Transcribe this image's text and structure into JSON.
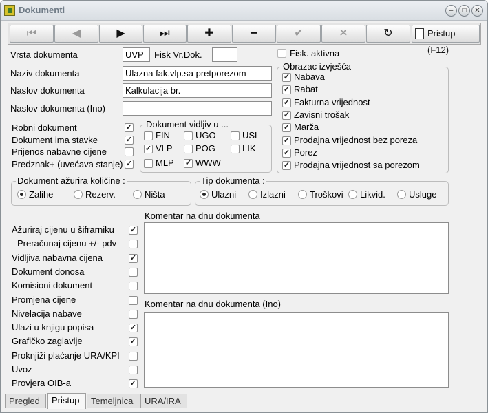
{
  "window": {
    "title": "Dokumenti"
  },
  "toolbar": {
    "first": "⏮",
    "prev": "◀",
    "next": "▶",
    "last": "⏭",
    "add": "✚",
    "remove": "━",
    "confirm": "✔",
    "cancel": "✕",
    "refresh": "↻",
    "pristup": "Pristup (F12)"
  },
  "fields": {
    "vrsta_label": "Vrsta dokumenta",
    "vrsta_value": "UVP",
    "fisk_label": "Fisk Vr.Dok.",
    "fisk_value": "",
    "fisk_aktivna_label": "Fisk. aktivna",
    "naziv_label": "Naziv dokumenta",
    "naziv_value": "Ulazna fak.vlp.sa pretporezom",
    "naslov_label": "Naslov dokumenta",
    "naslov_value": "Kalkulacija br.",
    "naslov_ino_label": "Naslov dokumenta (Ino)",
    "naslov_ino_value": ""
  },
  "left_checks": [
    {
      "label": "Robni dokument",
      "checked": true
    },
    {
      "label": "Dokument ima stavke",
      "checked": true
    },
    {
      "label": "Prijenos nabavne cijene",
      "checked": false
    },
    {
      "label": "Predznak+ (uvećava stanje)",
      "checked": true
    }
  ],
  "vidljiv": {
    "legend": "Dokument vidljiv u ...",
    "items": [
      {
        "label": "FIN",
        "checked": false
      },
      {
        "label": "UGO",
        "checked": false
      },
      {
        "label": "USL",
        "checked": false
      },
      {
        "label": "VLP",
        "checked": true
      },
      {
        "label": "POG",
        "checked": false
      },
      {
        "label": "LIK",
        "checked": false
      },
      {
        "label": "MLP",
        "checked": false
      },
      {
        "label": "WWW",
        "checked": true
      }
    ]
  },
  "obrazac": {
    "legend": "Obrazac izvješća",
    "items": [
      {
        "label": "Nabava",
        "checked": true
      },
      {
        "label": "Rabat",
        "checked": true
      },
      {
        "label": "Fakturna vrijednost",
        "checked": true
      },
      {
        "label": "Zavisni trošak",
        "checked": true
      },
      {
        "label": "Marža",
        "checked": true
      },
      {
        "label": "Prodajna vrijednost bez poreza",
        "checked": true
      },
      {
        "label": "Porez",
        "checked": true
      },
      {
        "label": "Prodajna vrijednost sa porezom",
        "checked": true
      }
    ]
  },
  "azurira": {
    "legend": "Dokument ažurira količine :",
    "options": [
      {
        "label": "Zalihe",
        "selected": true
      },
      {
        "label": "Rezerv.",
        "selected": false
      },
      {
        "label": "Ništa",
        "selected": false
      }
    ]
  },
  "tip": {
    "legend": "Tip dokumenta :",
    "options": [
      {
        "label": "Ulazni",
        "selected": true
      },
      {
        "label": "Izlazni",
        "selected": false
      },
      {
        "label": "Troškovi",
        "selected": false
      },
      {
        "label": "Likvid.",
        "selected": false
      },
      {
        "label": "Usluge",
        "selected": false
      }
    ]
  },
  "options": [
    {
      "label": "Ažuriraj cijenu u šifrarniku",
      "checked": true
    },
    {
      "label": "Preračunaj cijenu +/- pdv",
      "checked": false
    },
    {
      "label": "Vidljiva nabavna cijena",
      "checked": true
    },
    {
      "label": "Dokument donosa",
      "checked": false
    },
    {
      "label": "Komisioni dokument",
      "checked": false
    },
    {
      "label": "Promjena cijene",
      "checked": false
    },
    {
      "label": "Nivelacija nabave",
      "checked": false
    },
    {
      "label": "Ulazi u knjigu popisa",
      "checked": true
    },
    {
      "label": "Grafičko zaglavlje",
      "checked": true
    },
    {
      "label": "Proknjiži plaćanje URA/KPI",
      "checked": false
    },
    {
      "label": "Uvoz",
      "checked": false
    },
    {
      "label": "Provjera OIB-a",
      "checked": true
    }
  ],
  "komentar": {
    "label": "Komentar na dnu dokumenta",
    "ino_label": "Komentar na dnu dokumenta (Ino)"
  },
  "tabs": [
    "Pregled",
    "Pristup",
    "Temeljnica",
    "URA/IRA"
  ],
  "active_tab": "Pristup"
}
